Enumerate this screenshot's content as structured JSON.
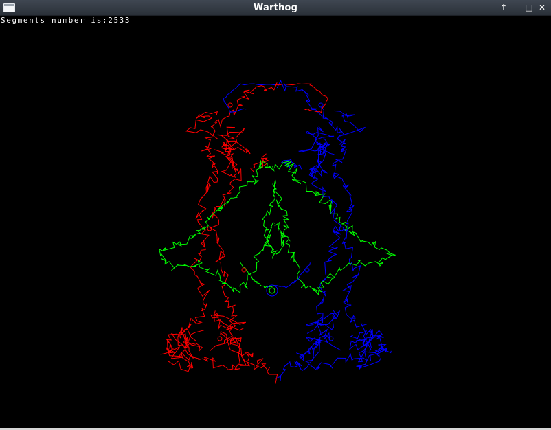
{
  "window": {
    "title": "Warthog",
    "buttons": {
      "up": "↑",
      "minimize": "–",
      "maximize": "□",
      "close": "✕"
    },
    "icon": "app-window-icon"
  },
  "status": {
    "label": "Segments number is:",
    "count": "2533"
  },
  "colors": {
    "background": "#000000",
    "red": "#ff0000",
    "blue": "#0000ff",
    "green": "#00ff00"
  }
}
